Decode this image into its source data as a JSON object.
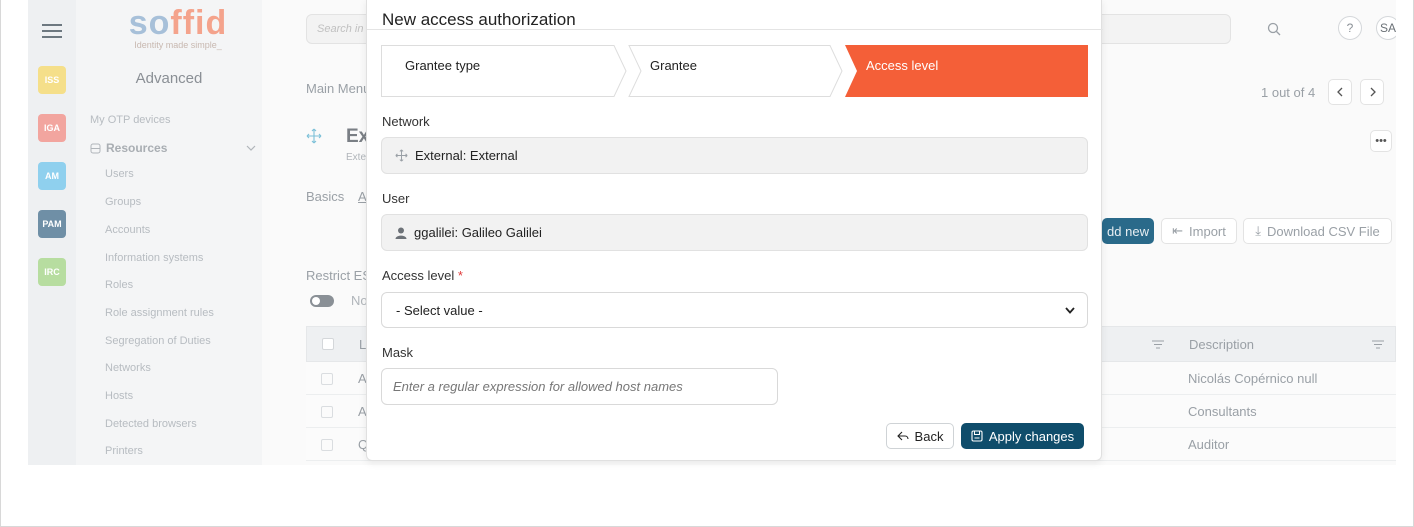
{
  "brand": {
    "logo_main": "so",
    "logo_accent": "ffid",
    "tagline": "Identity made simple_"
  },
  "rail": {
    "tiles": [
      {
        "label": "ISS",
        "color": "#f5df8a"
      },
      {
        "label": "IGA",
        "color": "#f2a59f"
      },
      {
        "label": "AM",
        "color": "#8fd0ee"
      },
      {
        "label": "PAM",
        "color": "#6f8fa6"
      },
      {
        "label": "IRC",
        "color": "#b7dda0"
      }
    ]
  },
  "sidebar": {
    "mode": "Advanced",
    "otp": "My OTP devices",
    "resources": "Resources",
    "items": [
      "Users",
      "Groups",
      "Accounts",
      "Information systems",
      "Roles",
      "Role assignment rules",
      "Segregation of Duties",
      "Networks",
      "Hosts",
      "Detected browsers",
      "Printers"
    ]
  },
  "header": {
    "search_placeholder": "Search in",
    "help": "?",
    "user_initials": "SA"
  },
  "background": {
    "breadcrumb": "Main Menu",
    "page_title": "Ex",
    "subtitle": "Exte",
    "tabs": [
      "Basics",
      "A"
    ],
    "pager": "1 out of 4",
    "add_new": "dd new",
    "import": "Import",
    "download": "Download CSV File",
    "restrict": "Restrict ES",
    "toggle_label": "No",
    "col_first": "L",
    "col_description": "Description",
    "rows": [
      {
        "first": "A",
        "description": "Nicolás Copérnico null"
      },
      {
        "first": "A",
        "description": "Consultants"
      },
      {
        "first": "Q",
        "description": "Auditor"
      }
    ]
  },
  "modal": {
    "title": "New access authorization",
    "steps": [
      "Grantee type",
      "Grantee",
      "Access level"
    ],
    "active_step_color": "#f45f38",
    "network_label": "Network",
    "network_value": "External: External",
    "user_label": "User",
    "user_value": "ggalilei: Galileo Galilei",
    "access_level_label": "Access level",
    "access_level_required": "*",
    "access_level_value": "- Select value -",
    "mask_label": "Mask",
    "mask_placeholder": "Enter a regular expression for allowed host names",
    "back_label": "Back",
    "apply_label": "Apply changes"
  }
}
